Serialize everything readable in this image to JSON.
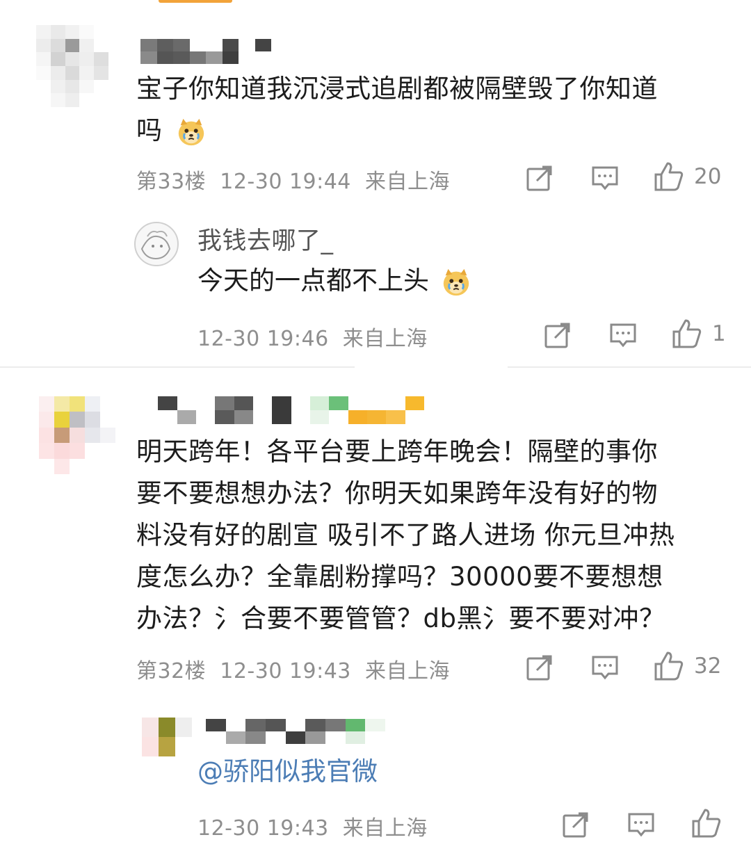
{
  "comments": [
    {
      "content_line1": "宝子你知道我沉浸式追剧都被隔壁毁了你知道",
      "content_line2": "吗",
      "emoji": "crying-dog-emoji",
      "floor": "第33楼",
      "time": "12-30 19:44",
      "location": "来自上海",
      "likes": "20",
      "reply": {
        "username": "我钱去哪了_",
        "content": "今天的一点都不上头",
        "emoji": "crying-dog-emoji",
        "time": "12-30 19:46",
        "location": "来自上海",
        "likes": "1"
      }
    },
    {
      "content_lines": [
        "明天跨年！各平台要上跨年晚会！隔壁的事你",
        "要不要想想办法？你明天如果跨年没有好的物",
        "料没有好的剧宣 吸引不了路人进场 你元旦冲热",
        "度怎么办？全靠剧粉撑吗？30000要不要想想",
        "办法？氵合要不要管管？db黑氵要不要对冲？"
      ],
      "floor": "第32楼",
      "time": "12-30 19:43",
      "location": "来自上海",
      "likes": "32",
      "reply": {
        "mention": "@骄阳似我官微",
        "time": "12-30 19:43",
        "location": "来自上海"
      }
    }
  ],
  "icons": {
    "share": "share-icon",
    "comment": "comment-icon",
    "like": "thumbs-up-icon"
  },
  "colors": {
    "meta_gray": "#8e8e8e",
    "mention_blue": "#4c7db5",
    "accent_orange": "#f2a33a"
  }
}
